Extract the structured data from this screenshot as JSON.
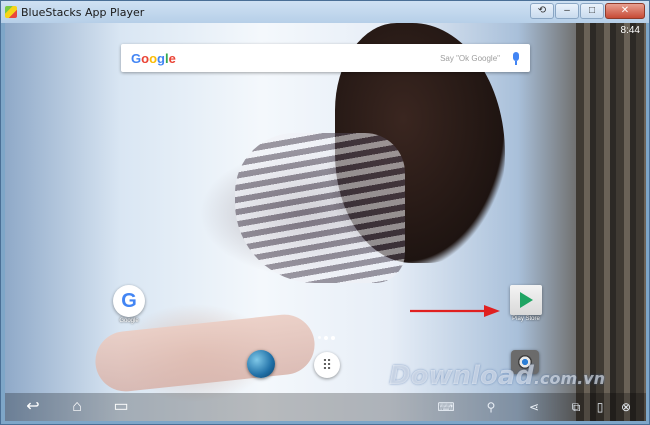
{
  "window": {
    "title": "BlueStacks App Player",
    "controls": {
      "back": "⟲",
      "minimize": "–",
      "maximize": "□",
      "close": "✕"
    }
  },
  "status_bar": {
    "time": "8:44"
  },
  "search_bar": {
    "logo_letters": [
      "G",
      "o",
      "o",
      "g",
      "l",
      "e"
    ],
    "hint": "Say \"Ok Google\"",
    "mic_icon": "microphone-icon"
  },
  "home_apps": [
    {
      "name": "Google",
      "icon": "google-icon"
    },
    {
      "name": "Play Store",
      "icon": "play-store-icon"
    },
    {
      "name": "",
      "icon": "browser-globe-icon"
    },
    {
      "name": "",
      "icon": "camera-icon"
    }
  ],
  "annotation": {
    "arrow_color": "#e02020"
  },
  "watermark": {
    "text": "Download",
    "suffix": ".com.vn"
  },
  "navbar": {
    "back_glyph": "↩",
    "home_glyph": "⌂",
    "recents_glyph": "▭",
    "keyboard_glyph": "⌨",
    "location_glyph": "⚲",
    "share_glyph": "⋖",
    "multiwindow_glyph": "⧉",
    "phone_glyph": "▯",
    "close_glyph": "⊗"
  },
  "colors": {
    "accent": "#4285f4",
    "play_green": "#1fa463",
    "title_bg": "#cfe1f3"
  }
}
